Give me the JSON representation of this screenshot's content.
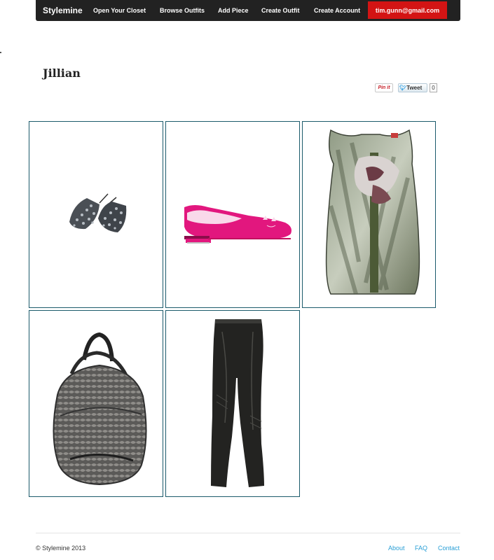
{
  "navbar": {
    "brand": "Stylemine",
    "items": [
      "Open Your Closet",
      "Browse Outfits",
      "Add Piece",
      "Create Outfit",
      "Create Account"
    ],
    "user_email": "tim.gunn@gmail.com"
  },
  "outfit": {
    "title": "Jillian"
  },
  "share": {
    "pin_label": "Pin it",
    "tweet_label": "Tweet",
    "tweet_count": "0"
  },
  "pieces": [
    {
      "name": "earrings"
    },
    {
      "name": "pink-flats"
    },
    {
      "name": "printed-sleeveless-top"
    },
    {
      "name": "snakeskin-bag"
    },
    {
      "name": "leather-leggings"
    }
  ],
  "footer": {
    "copyright": "© Stylemine 2013",
    "links": [
      "About",
      "FAQ",
      "Contact"
    ]
  },
  "colors": {
    "navbar": "#222222",
    "accent": "#d31414",
    "card_border": "#1b5a6b",
    "link": "#2a9fd6"
  }
}
